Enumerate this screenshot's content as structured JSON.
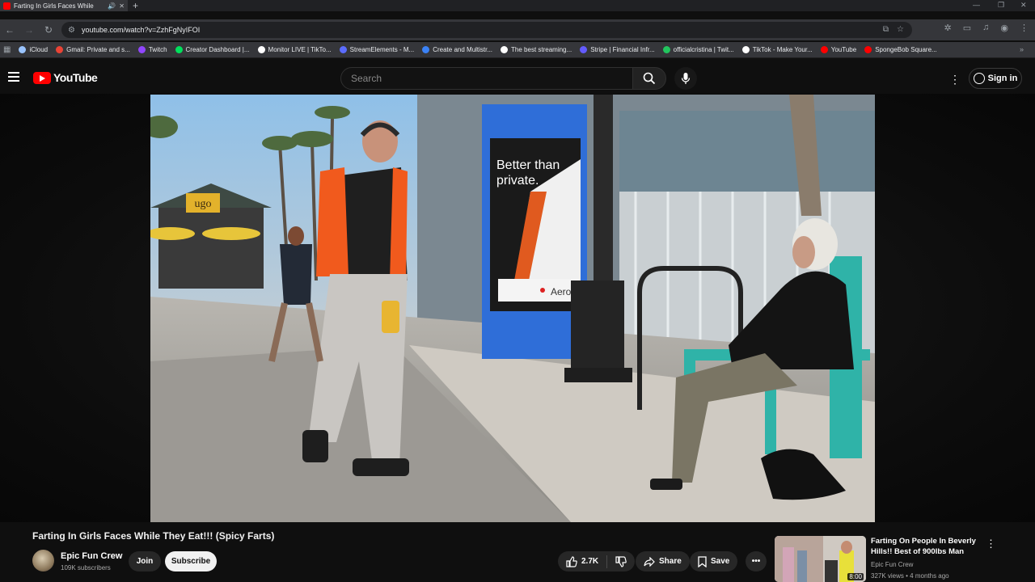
{
  "browser": {
    "tab_title": "Farting In Girls Faces While",
    "audio_icon": "speaker-icon",
    "url": "youtube.com/watch?v=ZzhFgNyIFOI",
    "bookmarks": [
      {
        "label": "iCloud",
        "color": "#9ac4ff"
      },
      {
        "label": "Gmail: Private and s...",
        "color": "#ea4335"
      },
      {
        "label": "Twitch",
        "color": "#9146ff"
      },
      {
        "label": "Creator Dashboard |...",
        "color": "#00e05c"
      },
      {
        "label": "Monitor LIVE | TikTo...",
        "color": "#ffffff"
      },
      {
        "label": "StreamElements - M...",
        "color": "#5b6cff"
      },
      {
        "label": "Create and Multistr...",
        "color": "#3b82f6"
      },
      {
        "label": "The best streaming...",
        "color": "#ffffff"
      },
      {
        "label": "Stripe | Financial Infr...",
        "color": "#635bff"
      },
      {
        "label": "officialcristina | Twit...",
        "color": "#22c55e"
      },
      {
        "label": "TikTok - Make Your...",
        "color": "#ffffff"
      },
      {
        "label": "YouTube",
        "color": "#ff0000"
      },
      {
        "label": "SpongeBob Square...",
        "color": "#ff0000"
      }
    ]
  },
  "youtube": {
    "logo_text": "YouTube",
    "search_placeholder": "Search",
    "signin_label": "Sign in"
  },
  "video": {
    "title": "Farting In Girls Faces While They Eat!!! (Spicy Farts)",
    "poster_text_line1": "Better than",
    "poster_text_line2": "private.",
    "poster_brand": "Aero",
    "kiosk_sign": "ugo",
    "channel": {
      "name": "Epic Fun Crew",
      "subscribers": "109K subscribers",
      "join_label": "Join",
      "subscribe_label": "Subscribe"
    },
    "actions": {
      "likes": "2.7K",
      "share_label": "Share",
      "save_label": "Save"
    }
  },
  "recommendation": {
    "title": "Farting On People In Beverly Hills!! Best of 900lbs Man",
    "channel": "Epic Fun Crew",
    "meta": "327K views • 4 months ago",
    "duration": "8:00"
  }
}
